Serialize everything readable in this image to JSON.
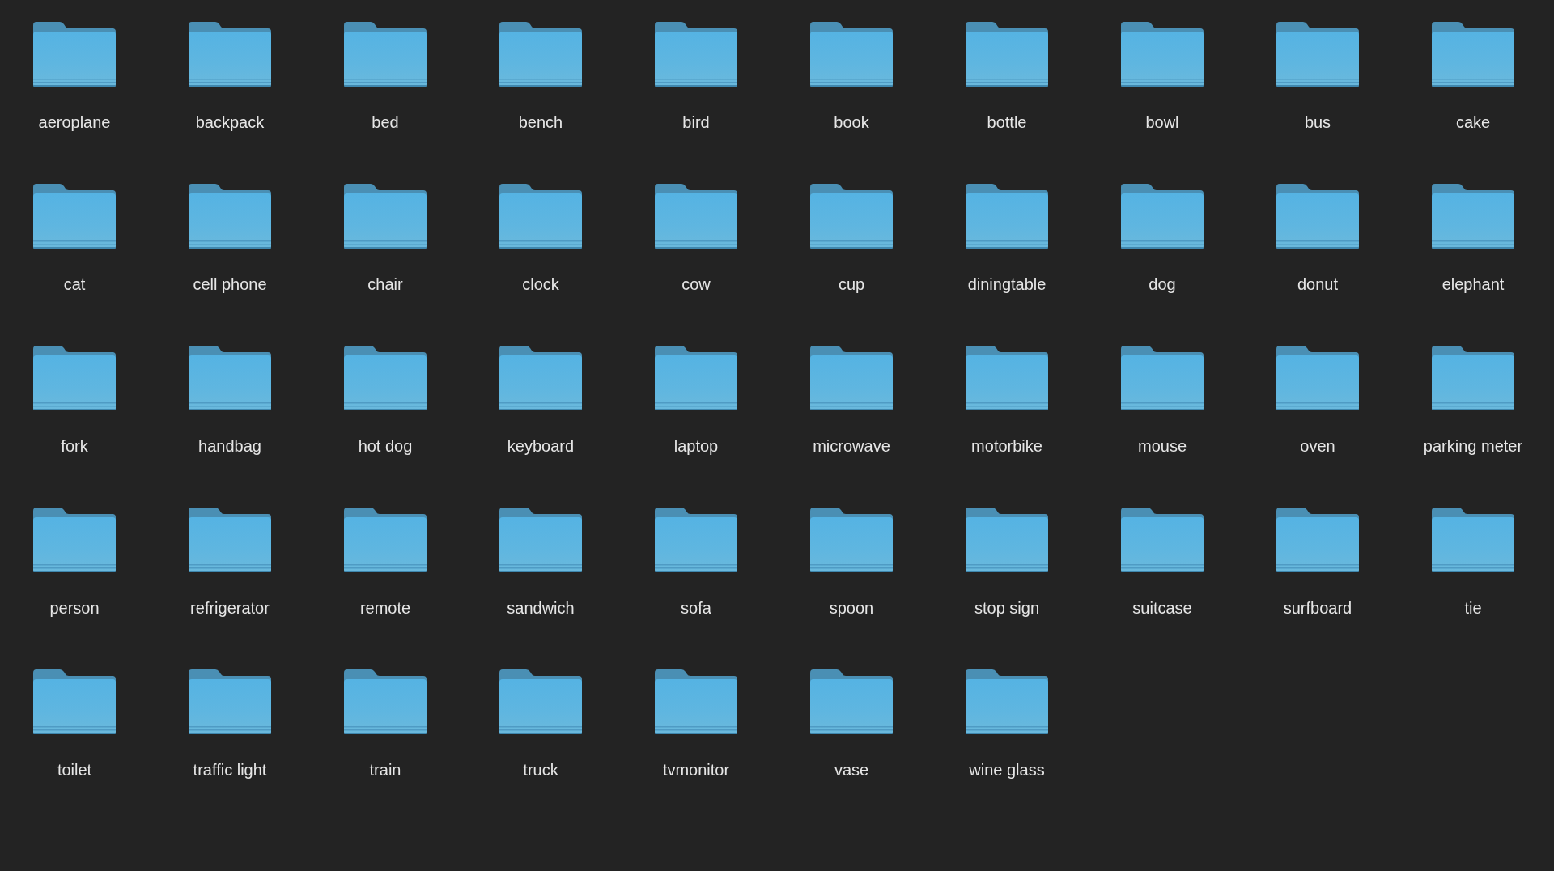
{
  "folders": [
    {
      "name": "aeroplane"
    },
    {
      "name": "backpack"
    },
    {
      "name": "bed"
    },
    {
      "name": "bench"
    },
    {
      "name": "bird"
    },
    {
      "name": "book"
    },
    {
      "name": "bottle"
    },
    {
      "name": "bowl"
    },
    {
      "name": "bus"
    },
    {
      "name": "cake"
    },
    {
      "name": "cat"
    },
    {
      "name": "cell phone"
    },
    {
      "name": "chair"
    },
    {
      "name": "clock"
    },
    {
      "name": "cow"
    },
    {
      "name": "cup"
    },
    {
      "name": "diningtable"
    },
    {
      "name": "dog"
    },
    {
      "name": "donut"
    },
    {
      "name": "elephant"
    },
    {
      "name": "fork"
    },
    {
      "name": "handbag"
    },
    {
      "name": "hot dog"
    },
    {
      "name": "keyboard"
    },
    {
      "name": "laptop"
    },
    {
      "name": "microwave"
    },
    {
      "name": "motorbike"
    },
    {
      "name": "mouse"
    },
    {
      "name": "oven"
    },
    {
      "name": "parking meter"
    },
    {
      "name": "person"
    },
    {
      "name": "refrigerator"
    },
    {
      "name": "remote"
    },
    {
      "name": "sandwich"
    },
    {
      "name": "sofa"
    },
    {
      "name": "spoon"
    },
    {
      "name": "stop sign"
    },
    {
      "name": "suitcase"
    },
    {
      "name": "surfboard"
    },
    {
      "name": "tie"
    },
    {
      "name": "toilet"
    },
    {
      "name": "traffic light"
    },
    {
      "name": "train"
    },
    {
      "name": "truck"
    },
    {
      "name": "tvmonitor"
    },
    {
      "name": "vase"
    },
    {
      "name": "wine glass"
    }
  ]
}
